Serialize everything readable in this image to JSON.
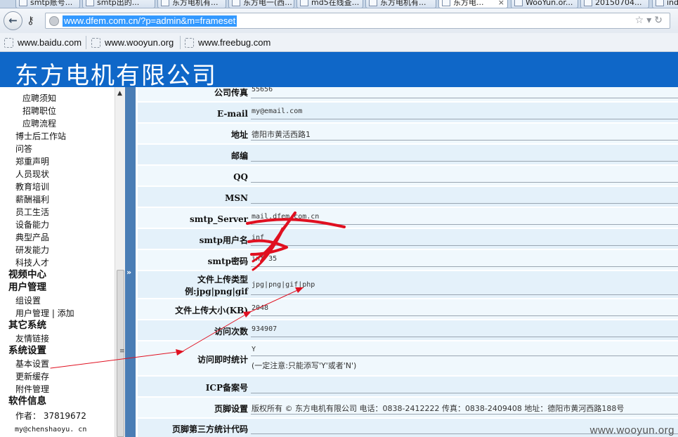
{
  "browser": {
    "tabs": [
      {
        "label": "smtp账号..."
      },
      {
        "label": "smtp出的..."
      },
      {
        "label": "东方电机有..."
      },
      {
        "label": "东方电一(西..."
      },
      {
        "label": "md5在线查..."
      },
      {
        "label": "东方电机有..."
      },
      {
        "label": "东方电...",
        "active": true
      },
      {
        "label": "WooYun.or..."
      },
      {
        "label": "20150704..."
      },
      {
        "label": "ind..."
      }
    ],
    "url": "www.dfem.com.cn/?p=admin&m=frameset",
    "bookmarks": [
      {
        "label": "www.baidu.com"
      },
      {
        "label": "www.wooyun.org"
      },
      {
        "label": "www.freebug.com"
      }
    ]
  },
  "banner": {
    "title": "东方电机有限公司"
  },
  "sidebar": {
    "items": [
      {
        "label": "应聘须知",
        "level": 2
      },
      {
        "label": "招聘职位",
        "level": 2
      },
      {
        "label": "应聘流程",
        "level": 2
      },
      {
        "label": "博士后工作站",
        "level": 1
      },
      {
        "label": "问答",
        "level": 1
      },
      {
        "label": "郑重声明",
        "level": 1
      },
      {
        "label": "人员现状",
        "level": 1
      },
      {
        "label": "教育培训",
        "level": 1
      },
      {
        "label": "薪酬福利",
        "level": 1
      },
      {
        "label": "员工生活",
        "level": 1
      },
      {
        "label": "设备能力",
        "level": 1
      },
      {
        "label": "典型产品",
        "level": 1
      },
      {
        "label": "研发能力",
        "level": 1
      },
      {
        "label": "科技人才",
        "level": 1
      },
      {
        "label": "视频中心",
        "level": 0
      },
      {
        "label": "用户管理",
        "level": 0
      },
      {
        "label": "组设置",
        "level": 1
      },
      {
        "label": "用户管理 | 添加",
        "level": 1
      },
      {
        "label": "其它系统",
        "level": 0
      },
      {
        "label": "友情链接",
        "level": 1
      },
      {
        "label": "系统设置",
        "level": 0
      },
      {
        "label": "基本设置",
        "level": 1
      },
      {
        "label": "更新缓存",
        "level": 1
      },
      {
        "label": "附件管理",
        "level": 1
      },
      {
        "label": "软件信息",
        "level": 0
      },
      {
        "label": "作者：   37819672",
        "level": 1
      },
      {
        "label": "my@chenshaoyu. cn",
        "level": 0,
        "small": true
      }
    ]
  },
  "form": {
    "rows": [
      {
        "label": "公司传真",
        "value": "55656"
      },
      {
        "label": "E-mail",
        "value": "my@email.com"
      },
      {
        "label": "地址",
        "value": "德阳市黄活西路1"
      },
      {
        "label": "邮编",
        "value": ""
      },
      {
        "label": "QQ",
        "value": ""
      },
      {
        "label": "MSN",
        "value": ""
      },
      {
        "label": "smtp_Server",
        "value": "mail.dfem.com.cn"
      },
      {
        "label": "smtp用户名",
        "value": "inf"
      },
      {
        "label": "smtp密码",
        "value": "inf   35"
      },
      {
        "label": "文件上传类型",
        "label2": "例:jpg|png|gif",
        "value": "jpg|png|gif|php"
      },
      {
        "label": "文件上传大小(KB)",
        "value": "2048"
      },
      {
        "label": "访问次数",
        "value": "934907"
      },
      {
        "label": "访问即时统计",
        "value": "Y",
        "note": "(一定注意:只能添写'Y'或者'N')"
      },
      {
        "label": "ICP备案号",
        "value": ""
      },
      {
        "label": "页脚设置",
        "value": "版权所有 © 东方电机有限公司 电话：0838-2412222 传真：0838-2409408 地址：德阳市黄河西路188号"
      },
      {
        "label": "页脚第三方统计代码",
        "value": ""
      }
    ]
  },
  "watermark": "www.wooyun.org",
  "icons": {
    "back": "back-arrow-icon",
    "key": "key-icon",
    "globe": "globe-icon",
    "star": "star-icon",
    "reload": "reload-icon",
    "bookmark": "bookmark-page-icon"
  },
  "colors": {
    "banner": "#0f67c8",
    "splitter": "#4a7db5",
    "row_light": "#f0f8fd",
    "row_dark": "#e4f1fa",
    "annotation": "#e01020",
    "url_highlight": "#3399ff"
  }
}
